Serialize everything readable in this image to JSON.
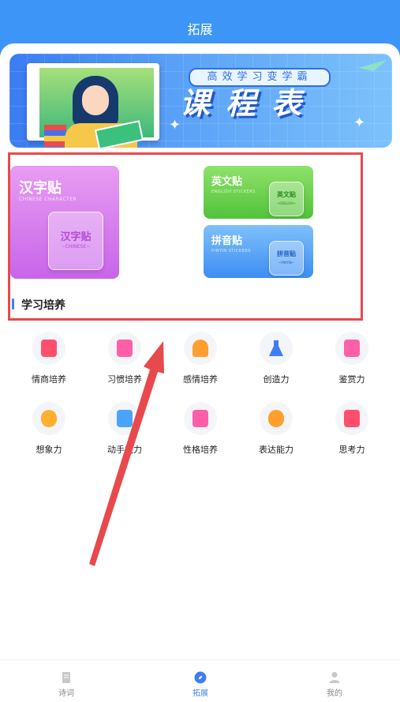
{
  "header": {
    "title": "拓展"
  },
  "banner": {
    "tagline": "高效学习变学霸",
    "headline": "课程表"
  },
  "cards": {
    "hanzi": {
      "title": "汉字贴",
      "subtitle": "CHINESE CHARACTER",
      "sticker_title": "汉字贴",
      "sticker_sub": "~CHINESE~"
    },
    "english": {
      "title": "英文贴",
      "subtitle": "ENGLISH STICKERS",
      "sticker_title": "英文贴",
      "sticker_sub": "~ENGLISH~"
    },
    "pinyin": {
      "title": "拼音贴",
      "subtitle": "PINYIN STICKERS",
      "sticker_title": "拼音贴",
      "sticker_sub": "~PINYIN~"
    }
  },
  "section": {
    "title": "学习培养"
  },
  "grid": [
    {
      "label": "情商培养",
      "icon": "book-icon",
      "color": "#ff4f6d"
    },
    {
      "label": "习惯培养",
      "icon": "journal-icon",
      "color": "#ff5fa8"
    },
    {
      "label": "感情培养",
      "icon": "house-icon",
      "color": "#ff9f2e"
    },
    {
      "label": "创造力",
      "icon": "flask-icon",
      "color": "#3d7ff2"
    },
    {
      "label": "鉴赏力",
      "icon": "certificate-icon",
      "color": "#ff5fa8"
    },
    {
      "label": "想象力",
      "icon": "bulb-icon",
      "color": "#ffb02e"
    },
    {
      "label": "动手能力",
      "icon": "star-book-icon",
      "color": "#4aa3ff"
    },
    {
      "label": "性格培养",
      "icon": "notebook-icon",
      "color": "#ff5fa8"
    },
    {
      "label": "表达能力",
      "icon": "bolt-icon",
      "color": "#ff9f2e"
    },
    {
      "label": "思考力",
      "icon": "calculator-icon",
      "color": "#ff4f6d"
    }
  ],
  "tabs": [
    {
      "label": "诗词",
      "icon": "book-icon",
      "active": false
    },
    {
      "label": "拓展",
      "icon": "compass-icon",
      "active": true
    },
    {
      "label": "我的",
      "icon": "person-icon",
      "active": false
    }
  ],
  "colors": {
    "primary": "#3d95f7",
    "highlight": "#e8494c",
    "arrow": "#e8494c"
  }
}
